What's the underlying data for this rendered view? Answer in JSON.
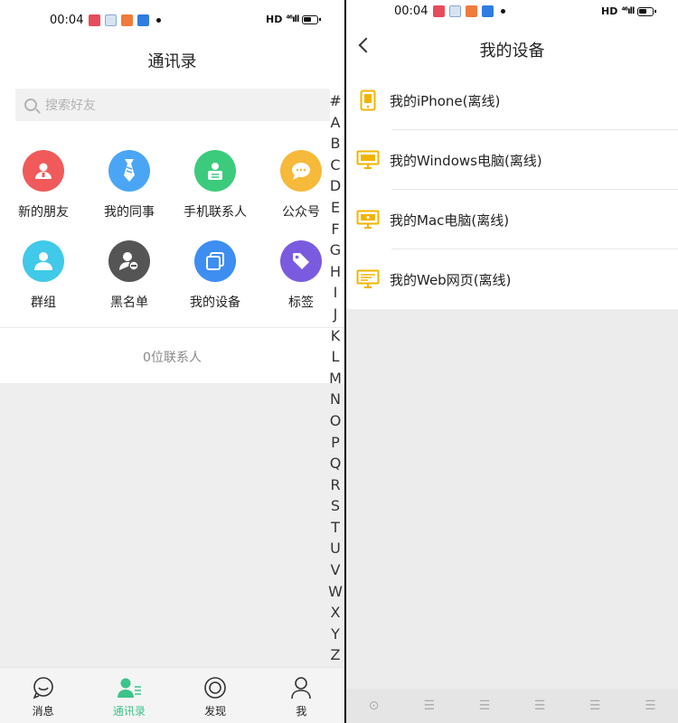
{
  "left": {
    "status_bar": {
      "time": "00:04",
      "network": "HD",
      "signal": "⁴⁶ıll"
    },
    "title": "通讯录",
    "search": {
      "placeholder": "搜索好友"
    },
    "grid": [
      {
        "label": "新的朋友",
        "icon": "person-badge-icon",
        "color": "#f05a5a"
      },
      {
        "label": "我的同事",
        "icon": "tie-icon",
        "color": "#4aa6f5"
      },
      {
        "label": "手机联系人",
        "icon": "contact-card-icon",
        "color": "#3ccb7c"
      },
      {
        "label": "公众号",
        "icon": "chat-bubble-icon",
        "color": "#f6b93a"
      },
      {
        "label": "群组",
        "icon": "group-icon",
        "color": "#40c9e8"
      },
      {
        "label": "黑名单",
        "icon": "block-user-icon",
        "color": "#555555"
      },
      {
        "label": "我的设备",
        "icon": "devices-icon",
        "color": "#3d8ef0"
      },
      {
        "label": "标签",
        "icon": "tag-icon",
        "color": "#7a5be0"
      }
    ],
    "contact_count": "0位联系人",
    "alphabet": [
      "#",
      "A",
      "B",
      "C",
      "D",
      "E",
      "F",
      "G",
      "H",
      "I",
      "J",
      "K",
      "L",
      "M",
      "N",
      "O",
      "P",
      "Q",
      "R",
      "S",
      "T",
      "U",
      "V",
      "W",
      "X",
      "Y",
      "Z"
    ],
    "nav": [
      {
        "label": "消息",
        "icon": "message-icon",
        "active": false
      },
      {
        "label": "通讯录",
        "icon": "contacts-icon",
        "active": true
      },
      {
        "label": "发现",
        "icon": "discover-icon",
        "active": false
      },
      {
        "label": "我",
        "icon": "profile-icon",
        "active": false
      }
    ]
  },
  "right": {
    "status_bar": {
      "time": "00:04",
      "network": "HD",
      "signal": "⁴⁶ıll"
    },
    "title": "我的设备",
    "devices": [
      {
        "label": "我的iPhone(离线)",
        "icon": "phone-icon"
      },
      {
        "label": "我的Windows电脑(离线)",
        "icon": "desktop-icon"
      },
      {
        "label": "我的Mac电脑(离线)",
        "icon": "mac-desktop-icon"
      },
      {
        "label": "我的Web网页(离线)",
        "icon": "web-monitor-icon"
      }
    ]
  },
  "colors": {
    "accent": "#3cc489",
    "device_icon": "#f3b400"
  }
}
